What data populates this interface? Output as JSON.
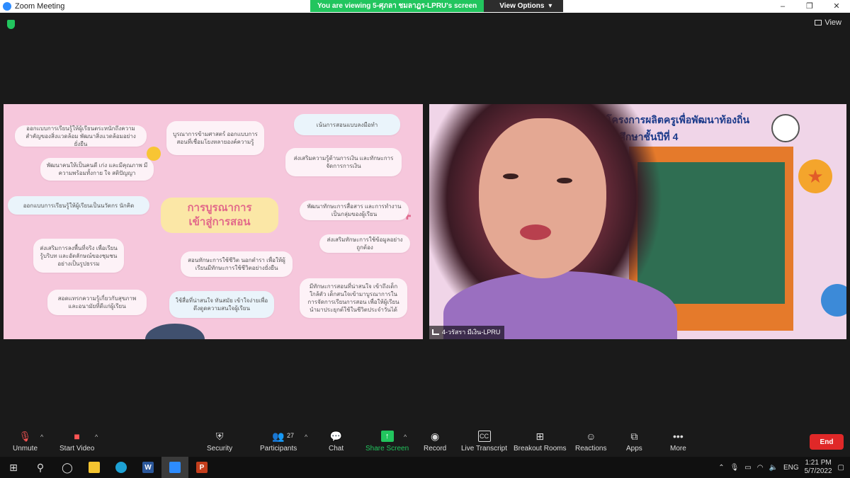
{
  "window": {
    "title": "Zoom Meeting",
    "banner": "You are viewing 5-ศุภลา ชมลาฎร-LPRU's screen",
    "view_options": "View Options",
    "minimize": "–",
    "restore": "❐",
    "close": "✕"
  },
  "meeting": {
    "view_label": "View"
  },
  "slide": {
    "center_title": "การบูรณาการ\nเข้าสู่การสอน",
    "bubbles": [
      "ออกแบบการเรียนรู้ให้ผู้เรียนตระหนักถึงความสำคัญของสิ่งแวดล้อม พัฒนาสิ่งแวดล้อมอย่างยั่งยืน",
      "บูรณาการข้ามศาสตร์ ออกแบบการสอนที่เชื่อมโยงหลายองค์ความรู้",
      "เน้นการสอนแบบลงมือทำ",
      "พัฒนาคนให้เป็นคนดี เก่ง และมีคุณภาพ มีความพร้อมทั้งกาย ใจ สติปัญญา",
      "ส่งเสริมความรู้ด้านการเงิน และทักษะการจัดการการเงิน",
      "ออกแบบการเรียนรู้ให้ผู้เรียนเป็นนวัตกร นักคิด",
      "พัฒนาทักษะการสื่อสาร และการทำงานเป็นกลุ่มของผู้เรียน",
      "ส่งเสริมการลงพื้นที่จริง เพื่อเรียนรู้บริบท และอัตลักษณ์ของชุมชนอย่างเป็นรูปธรรม",
      "สอนทักษะการใช้ชีวิต นอกตำรา เพื่อให้ผู้เรียนมีทักษะการใช้ชีวิตอย่างยั่งยืน",
      "ส่งเสริมทักษะการใช้ข้อมูลอย่างถูกต้อง",
      "สอดแทรกความรู้เกี่ยวกับสุขภาพ และอนามัยที่ดีแก่ผู้เรียน",
      "ใช้สื่อที่น่าสนใจ ทันสมัย เข้าใจง่ายเพื่อดึงดูดความสนใจผู้เรียน",
      "มีทักษะการสอนที่น่าสนใจ เข้าถึงเด็กใกล้ตัว เด็กสนใจเข้ามาบูรณาการในการจัดการเรียนการสอน เพื่อให้ผู้เรียนนำมาประยุกต์ใช้ในชีวิตประจำวันได้"
    ]
  },
  "camera": {
    "title_line1": "โครงการผลิตครูเพื่อพัฒนาท้องถิ่น",
    "title_line2": "นักศึกษาชั้นปีที่ 4",
    "participant_name": "4-วรัสรา มีเงิน-LPRU"
  },
  "toolbar": {
    "unmute": "Unmute",
    "start_video": "Start Video",
    "security": "Security",
    "participants": "Participants",
    "participants_count": "27",
    "chat": "Chat",
    "share_screen": "Share Screen",
    "record": "Record",
    "live_transcript": "Live Transcript",
    "breakout_rooms": "Breakout Rooms",
    "reactions": "Reactions",
    "apps": "Apps",
    "more": "More",
    "end": "End",
    "cc": "CC"
  },
  "taskbar": {
    "time": "1:21 PM",
    "date": "5/7/2022",
    "language": "ENG",
    "word_letter": "W",
    "ppt_letter": "P"
  },
  "colors": {
    "zoom_blue": "#2d8cff",
    "share_green": "#22c55e",
    "end_red": "#e02828",
    "slide_pink": "#f6c7dc"
  }
}
